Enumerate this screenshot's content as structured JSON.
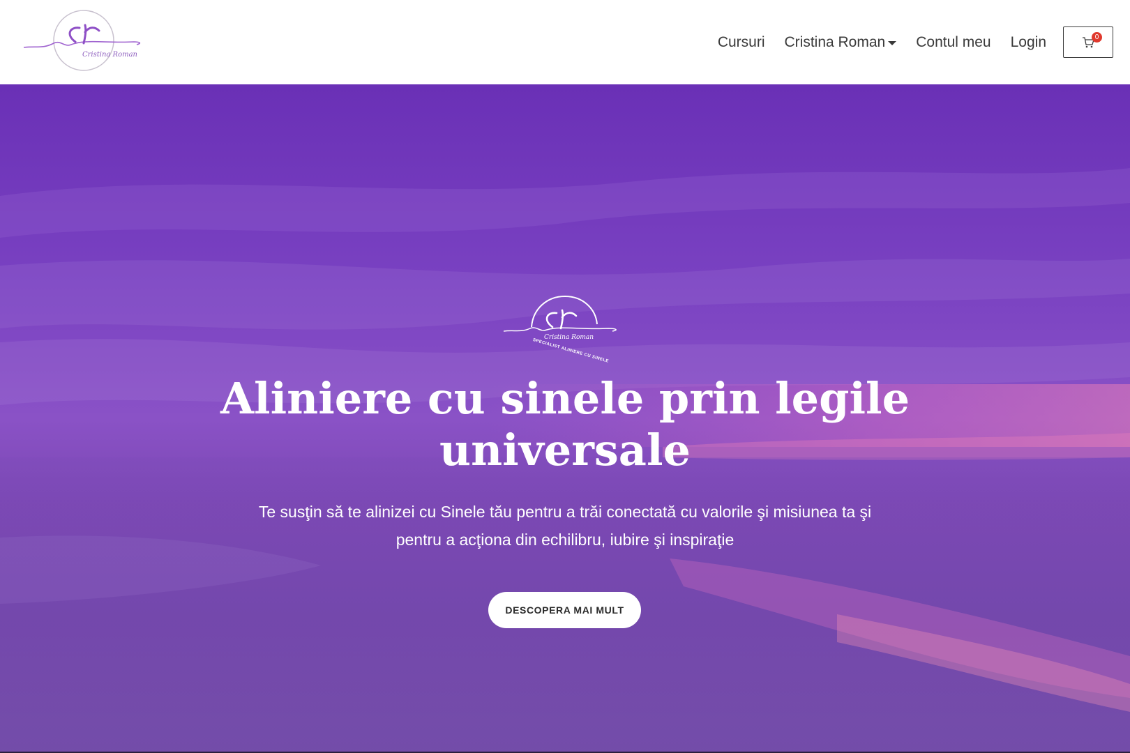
{
  "header": {
    "logo_script": "Cristina Roman",
    "nav": [
      {
        "label": "Cursuri"
      },
      {
        "label": "Cristina Roman"
      },
      {
        "label": "Contul meu"
      },
      {
        "label": "Login"
      }
    ],
    "cart_count": "0"
  },
  "hero": {
    "logo_script": "Cristina Roman",
    "logo_tagline": "SPECIALIST ALINIERE CU SINELE",
    "title": "Aliniere cu sinele prin legile universale",
    "subtitle": "Te susţin să te alinizei cu Sinele tău pentru a trăi conectată cu valorile şi misiunea ta şi pentru a acţiona din echilibru, iubire şi inspiraţie",
    "cta_label": "DESCOPERA MAI MULT"
  },
  "icons": {
    "cart": "shopping-cart-icon",
    "caret": "caret-down-icon"
  },
  "colors": {
    "brand_purple": "#8e5fbf",
    "hero_purple": "#6a30b6",
    "badge_red": "#e0392d",
    "text_dark": "#3a3a3a"
  }
}
